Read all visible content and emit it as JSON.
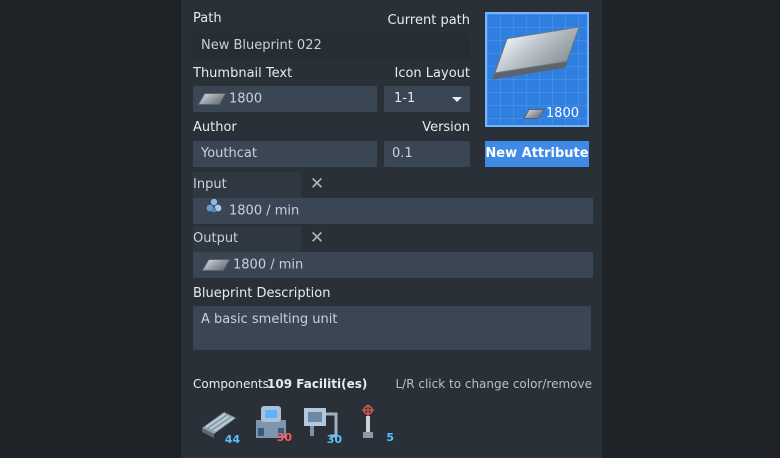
{
  "path": {
    "label": "Path",
    "current_path_label": "Current path",
    "value": "New Blueprint 022"
  },
  "thumbnail": {
    "label": "Thumbnail Text",
    "value": "1800",
    "icon": "iron-plate-icon"
  },
  "icon_layout": {
    "label": "Icon Layout",
    "value": "1-1"
  },
  "author": {
    "label": "Author",
    "value": "Youthcat"
  },
  "version": {
    "label": "Version",
    "value": "0.1"
  },
  "preview": {
    "badge_value": "1800",
    "icon": "iron-plate-icon"
  },
  "new_attribute_label": "New Attribute",
  "input": {
    "label": "Input",
    "rate": "1800 / min",
    "icon": "iron-ore-icon"
  },
  "output": {
    "label": "Output",
    "rate": "1800 / min",
    "icon": "iron-plate-icon"
  },
  "description": {
    "label": "Blueprint  Description",
    "value": "A basic smelting unit"
  },
  "components": {
    "label": "Components",
    "count_text": "109 Faciliti(es)",
    "hint": "L/R click to change color/remove",
    "items": [
      {
        "name": "conveyor-belt-icon",
        "count": "44",
        "color": "#5cc0ff"
      },
      {
        "name": "smelter-icon",
        "count": "30",
        "color": "#ff5c5c"
      },
      {
        "name": "sorter-icon",
        "count": "30",
        "color": "#5cc0ff"
      },
      {
        "name": "tesla-tower-icon",
        "count": "5",
        "color": "#5cc0ff"
      }
    ]
  },
  "colors": {
    "panel": "#2a3038",
    "field": "#3a4654",
    "accent": "#3f8ae6",
    "preview": "#2f7fe0"
  }
}
